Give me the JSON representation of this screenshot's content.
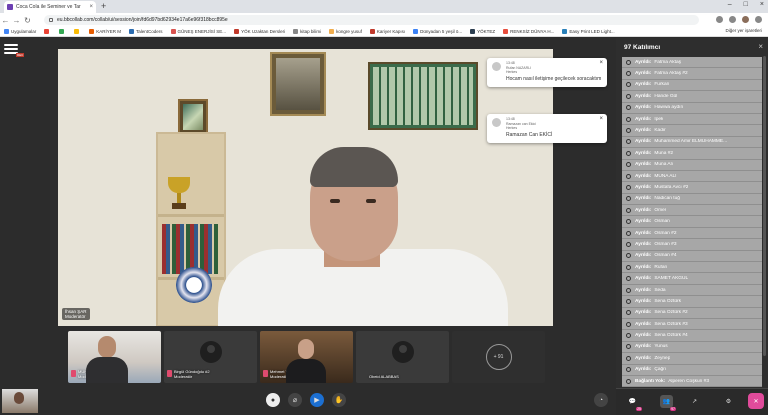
{
  "browser": {
    "tab_title": "Coca Cola ile Seminer ve Tar",
    "tab_close": "×",
    "new_tab": "+",
    "window_controls": [
      "–",
      "□",
      "×"
    ],
    "url": "eu.bbcollab.com/collab/ui/session/join/fd6d97bd62934e17a6e96f318bcc895e",
    "bookmarks": [
      {
        "label": "Uygulamalar",
        "color": "#4285f4"
      },
      {
        "label": "",
        "color": "#ea4335"
      },
      {
        "label": "",
        "color": "#34a853"
      },
      {
        "label": "",
        "color": "#fbbc05"
      },
      {
        "label": "KARİYER M",
        "color": "#e65c00"
      },
      {
        "label": "TalentCoders",
        "color": "#2b6cb0"
      },
      {
        "label": "GÜNEŞ ENERJİSİ SE...",
        "color": "#d9534f"
      },
      {
        "label": "YÖK Uzaktan Dersleri",
        "color": "#c0392b"
      },
      {
        "label": "kitap bilimi",
        "color": "#888888"
      },
      {
        "label": "kongre yusuf",
        "color": "#f0ad4e"
      },
      {
        "label": "Kariyer Kapısı",
        "color": "#c0392b"
      },
      {
        "label": "Dünyadan 5 yeşil ö...",
        "color": "#3b82f6"
      },
      {
        "label": "YÖKTEZ",
        "color": "#2c3e50"
      },
      {
        "label": "RENKSİZ DÜNYA H...",
        "color": "#e74c3c"
      },
      {
        "label": "Easy Print LED Light...",
        "color": "#2980b9"
      }
    ],
    "other_bookmarks": "Diğer yer işaretleri"
  },
  "app": {
    "rec_badge": "REC",
    "speaker_name": "İhsan ŞAR",
    "speaker_role": "Moderatör",
    "toasts": [
      {
        "time": "13:48",
        "from": "Rufan NAZARLI",
        "to": "Herkes",
        "message": "Hocam nasıl iletişime geçilecek soracaktım"
      },
      {
        "time": "13:48",
        "from": "Ramazan can Ekici",
        "to": "Herkes",
        "message": "Ramazan Can EKİCİ"
      }
    ],
    "toast_close": "×",
    "tiles": [
      {
        "name": "MUHAMMED ZENCİRCİ",
        "role": "Moderatör"
      },
      {
        "name": "Birgül Gündoğdu #2",
        "role": "Moderatör"
      },
      {
        "name": "Mehmet YILMAZ",
        "role": "Moderatör"
      },
      {
        "name": "Obeid ALABBAS",
        "role": ""
      }
    ],
    "more_participants": "+ 91"
  },
  "sidebar": {
    "title": "97 Katılımcı",
    "close": "×",
    "participants": [
      {
        "status": "Ayrıldı:",
        "name": "Fatma Aktaş"
      },
      {
        "status": "Ayrıldı:",
        "name": "Fatma Aktaş #2"
      },
      {
        "status": "Ayrıldı:",
        "name": "Furkan"
      },
      {
        "status": "Ayrıldı:",
        "name": "Hande Gül"
      },
      {
        "status": "Ayrıldı:",
        "name": "Hawwa aydın"
      },
      {
        "status": "Ayrıldı:",
        "name": "İpek"
      },
      {
        "status": "Ayrıldı:",
        "name": "Kadir"
      },
      {
        "status": "Ayrıldı:",
        "name": "Muhammed Amir ELMUHAMME..."
      },
      {
        "status": "Ayrıldı:",
        "name": "Muna #2"
      },
      {
        "status": "Ayrıldı:",
        "name": "Muna Ali"
      },
      {
        "status": "Ayrıldı:",
        "name": "MUNA ALI"
      },
      {
        "status": "Ayrıldı:",
        "name": "Mustafa Avcı #2"
      },
      {
        "status": "Ayrıldı:",
        "name": "Nadican tuğ"
      },
      {
        "status": "Ayrıldı:",
        "name": "Omer"
      },
      {
        "status": "Ayrıldı:",
        "name": "Osman"
      },
      {
        "status": "Ayrıldı:",
        "name": "Osman #2"
      },
      {
        "status": "Ayrıldı:",
        "name": "Osman #3"
      },
      {
        "status": "Ayrıldı:",
        "name": "Osman #4"
      },
      {
        "status": "Ayrıldı:",
        "name": "Rufan"
      },
      {
        "status": "Ayrıldı:",
        "name": "SAMET AKGÜL"
      },
      {
        "status": "Ayrıldı:",
        "name": "Seda"
      },
      {
        "status": "Ayrıldı:",
        "name": "Sena Öztürk"
      },
      {
        "status": "Ayrıldı:",
        "name": "Sena Öztürk #2"
      },
      {
        "status": "Ayrıldı:",
        "name": "Sena Öztürk #3"
      },
      {
        "status": "Ayrıldı:",
        "name": "Sena Öztürk #4"
      },
      {
        "status": "Ayrıldı:",
        "name": "Yunus"
      },
      {
        "status": "Ayrıldı:",
        "name": "Zeynep"
      },
      {
        "status": "Ayrıldı:",
        "name": "Çağrı"
      },
      {
        "status": "Bağlantı Yok:",
        "name": "Alperen Coşkun #3"
      }
    ],
    "tab_badges": {
      "chat": "25",
      "people": "97"
    },
    "accent": "#e04b9b"
  }
}
